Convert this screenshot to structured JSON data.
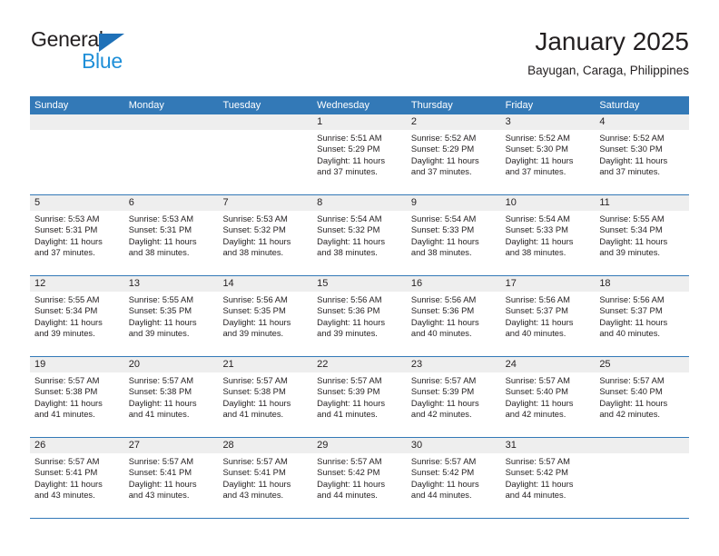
{
  "brand": {
    "name_top": "General",
    "name_bottom": "Blue",
    "triangle_color": "#1f71b8",
    "bottom_color": "#1f8fd8"
  },
  "header": {
    "month_title": "January 2025",
    "location": "Bayugan, Caraga, Philippines"
  },
  "theme": {
    "header_blue": "#3379b7",
    "day_band_gray": "#eeeeee",
    "text_color": "#231f20"
  },
  "weekdays": [
    "Sunday",
    "Monday",
    "Tuesday",
    "Wednesday",
    "Thursday",
    "Friday",
    "Saturday"
  ],
  "weeks": [
    [
      {
        "day": "",
        "empty": true
      },
      {
        "day": "",
        "empty": true
      },
      {
        "day": "",
        "empty": true
      },
      {
        "day": "1",
        "sunrise": "Sunrise: 5:51 AM",
        "sunset": "Sunset: 5:29 PM",
        "daylight1": "Daylight: 11 hours",
        "daylight2": "and 37 minutes."
      },
      {
        "day": "2",
        "sunrise": "Sunrise: 5:52 AM",
        "sunset": "Sunset: 5:29 PM",
        "daylight1": "Daylight: 11 hours",
        "daylight2": "and 37 minutes."
      },
      {
        "day": "3",
        "sunrise": "Sunrise: 5:52 AM",
        "sunset": "Sunset: 5:30 PM",
        "daylight1": "Daylight: 11 hours",
        "daylight2": "and 37 minutes."
      },
      {
        "day": "4",
        "sunrise": "Sunrise: 5:52 AM",
        "sunset": "Sunset: 5:30 PM",
        "daylight1": "Daylight: 11 hours",
        "daylight2": "and 37 minutes."
      }
    ],
    [
      {
        "day": "5",
        "sunrise": "Sunrise: 5:53 AM",
        "sunset": "Sunset: 5:31 PM",
        "daylight1": "Daylight: 11 hours",
        "daylight2": "and 37 minutes."
      },
      {
        "day": "6",
        "sunrise": "Sunrise: 5:53 AM",
        "sunset": "Sunset: 5:31 PM",
        "daylight1": "Daylight: 11 hours",
        "daylight2": "and 38 minutes."
      },
      {
        "day": "7",
        "sunrise": "Sunrise: 5:53 AM",
        "sunset": "Sunset: 5:32 PM",
        "daylight1": "Daylight: 11 hours",
        "daylight2": "and 38 minutes."
      },
      {
        "day": "8",
        "sunrise": "Sunrise: 5:54 AM",
        "sunset": "Sunset: 5:32 PM",
        "daylight1": "Daylight: 11 hours",
        "daylight2": "and 38 minutes."
      },
      {
        "day": "9",
        "sunrise": "Sunrise: 5:54 AM",
        "sunset": "Sunset: 5:33 PM",
        "daylight1": "Daylight: 11 hours",
        "daylight2": "and 38 minutes."
      },
      {
        "day": "10",
        "sunrise": "Sunrise: 5:54 AM",
        "sunset": "Sunset: 5:33 PM",
        "daylight1": "Daylight: 11 hours",
        "daylight2": "and 38 minutes."
      },
      {
        "day": "11",
        "sunrise": "Sunrise: 5:55 AM",
        "sunset": "Sunset: 5:34 PM",
        "daylight1": "Daylight: 11 hours",
        "daylight2": "and 39 minutes."
      }
    ],
    [
      {
        "day": "12",
        "sunrise": "Sunrise: 5:55 AM",
        "sunset": "Sunset: 5:34 PM",
        "daylight1": "Daylight: 11 hours",
        "daylight2": "and 39 minutes."
      },
      {
        "day": "13",
        "sunrise": "Sunrise: 5:55 AM",
        "sunset": "Sunset: 5:35 PM",
        "daylight1": "Daylight: 11 hours",
        "daylight2": "and 39 minutes."
      },
      {
        "day": "14",
        "sunrise": "Sunrise: 5:56 AM",
        "sunset": "Sunset: 5:35 PM",
        "daylight1": "Daylight: 11 hours",
        "daylight2": "and 39 minutes."
      },
      {
        "day": "15",
        "sunrise": "Sunrise: 5:56 AM",
        "sunset": "Sunset: 5:36 PM",
        "daylight1": "Daylight: 11 hours",
        "daylight2": "and 39 minutes."
      },
      {
        "day": "16",
        "sunrise": "Sunrise: 5:56 AM",
        "sunset": "Sunset: 5:36 PM",
        "daylight1": "Daylight: 11 hours",
        "daylight2": "and 40 minutes."
      },
      {
        "day": "17",
        "sunrise": "Sunrise: 5:56 AM",
        "sunset": "Sunset: 5:37 PM",
        "daylight1": "Daylight: 11 hours",
        "daylight2": "and 40 minutes."
      },
      {
        "day": "18",
        "sunrise": "Sunrise: 5:56 AM",
        "sunset": "Sunset: 5:37 PM",
        "daylight1": "Daylight: 11 hours",
        "daylight2": "and 40 minutes."
      }
    ],
    [
      {
        "day": "19",
        "sunrise": "Sunrise: 5:57 AM",
        "sunset": "Sunset: 5:38 PM",
        "daylight1": "Daylight: 11 hours",
        "daylight2": "and 41 minutes."
      },
      {
        "day": "20",
        "sunrise": "Sunrise: 5:57 AM",
        "sunset": "Sunset: 5:38 PM",
        "daylight1": "Daylight: 11 hours",
        "daylight2": "and 41 minutes."
      },
      {
        "day": "21",
        "sunrise": "Sunrise: 5:57 AM",
        "sunset": "Sunset: 5:38 PM",
        "daylight1": "Daylight: 11 hours",
        "daylight2": "and 41 minutes."
      },
      {
        "day": "22",
        "sunrise": "Sunrise: 5:57 AM",
        "sunset": "Sunset: 5:39 PM",
        "daylight1": "Daylight: 11 hours",
        "daylight2": "and 41 minutes."
      },
      {
        "day": "23",
        "sunrise": "Sunrise: 5:57 AM",
        "sunset": "Sunset: 5:39 PM",
        "daylight1": "Daylight: 11 hours",
        "daylight2": "and 42 minutes."
      },
      {
        "day": "24",
        "sunrise": "Sunrise: 5:57 AM",
        "sunset": "Sunset: 5:40 PM",
        "daylight1": "Daylight: 11 hours",
        "daylight2": "and 42 minutes."
      },
      {
        "day": "25",
        "sunrise": "Sunrise: 5:57 AM",
        "sunset": "Sunset: 5:40 PM",
        "daylight1": "Daylight: 11 hours",
        "daylight2": "and 42 minutes."
      }
    ],
    [
      {
        "day": "26",
        "sunrise": "Sunrise: 5:57 AM",
        "sunset": "Sunset: 5:41 PM",
        "daylight1": "Daylight: 11 hours",
        "daylight2": "and 43 minutes."
      },
      {
        "day": "27",
        "sunrise": "Sunrise: 5:57 AM",
        "sunset": "Sunset: 5:41 PM",
        "daylight1": "Daylight: 11 hours",
        "daylight2": "and 43 minutes."
      },
      {
        "day": "28",
        "sunrise": "Sunrise: 5:57 AM",
        "sunset": "Sunset: 5:41 PM",
        "daylight1": "Daylight: 11 hours",
        "daylight2": "and 43 minutes."
      },
      {
        "day": "29",
        "sunrise": "Sunrise: 5:57 AM",
        "sunset": "Sunset: 5:42 PM",
        "daylight1": "Daylight: 11 hours",
        "daylight2": "and 44 minutes."
      },
      {
        "day": "30",
        "sunrise": "Sunrise: 5:57 AM",
        "sunset": "Sunset: 5:42 PM",
        "daylight1": "Daylight: 11 hours",
        "daylight2": "and 44 minutes."
      },
      {
        "day": "31",
        "sunrise": "Sunrise: 5:57 AM",
        "sunset": "Sunset: 5:42 PM",
        "daylight1": "Daylight: 11 hours",
        "daylight2": "and 44 minutes."
      },
      {
        "day": "",
        "empty": true
      }
    ]
  ]
}
